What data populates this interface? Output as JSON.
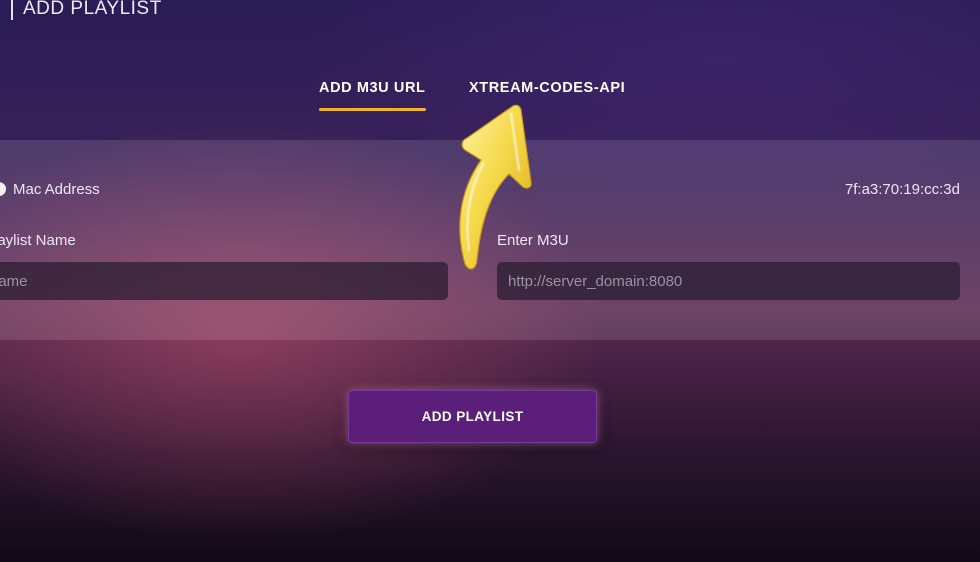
{
  "header": {
    "title": "ADD PLAYLIST"
  },
  "tabs": [
    {
      "label": "ADD M3U URL",
      "active": true
    },
    {
      "label": "XTREAM-CODES-API",
      "active": false
    }
  ],
  "form": {
    "mac_label": "Mac Address",
    "mac_value": "7f:a3:70:19:cc:3d",
    "playlist_name_label": "laylist Name",
    "playlist_name_placeholder": "name",
    "m3u_label": "Enter M3U",
    "m3u_placeholder": "http://server_domain:8080"
  },
  "submit": {
    "label": "ADD PLAYLIST"
  },
  "colors": {
    "accent_underline": "#f0b429",
    "button_bg": "#5b1e7a",
    "arrow": "#f5d94a"
  },
  "icons": {
    "overlay": "curved-arrow-icon"
  }
}
